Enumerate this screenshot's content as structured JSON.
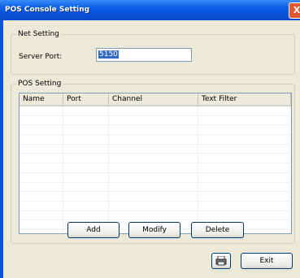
{
  "window": {
    "title": "POS Console Setting",
    "close_glyph": "X"
  },
  "net_setting": {
    "title": "Net Setting",
    "port_label": "Server Port:",
    "port_value": "5150"
  },
  "pos_setting": {
    "title": "POS Setting",
    "columns": [
      "Name",
      "Port",
      "Channel",
      "Text Filter"
    ],
    "rows": []
  },
  "buttons": {
    "add": "Add",
    "modify": "Modify",
    "delete": "Delete",
    "exit": "Exit",
    "print_icon": "printer-icon"
  }
}
